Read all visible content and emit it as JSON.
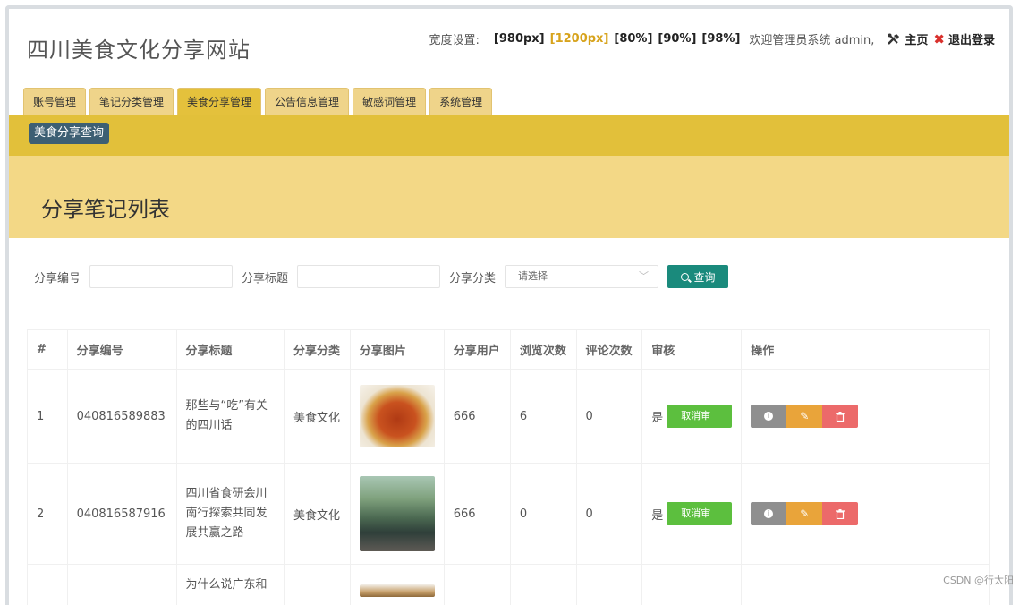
{
  "site": {
    "title": "四川美食文化分享网站"
  },
  "topbar": {
    "width_label": "宽度设置:",
    "width_options": [
      "[980px]",
      "[1200px]",
      "[80%]",
      "[90%]",
      "[98%]"
    ],
    "welcome": "欢迎管理员系统 admin,",
    "home": "主页",
    "logout": "退出登录"
  },
  "tabs": [
    "账号管理",
    "笔记分类管理",
    "美食分享管理",
    "公告信息管理",
    "敏感词管理",
    "系统管理"
  ],
  "subnav": {
    "button": "美食分享查询"
  },
  "page": {
    "title": "分享笔记列表"
  },
  "filters": {
    "id_label": "分享编号",
    "title_label": "分享标题",
    "category_label": "分享分类",
    "category_placeholder": "请选择",
    "search_button": "查询"
  },
  "table": {
    "headers": [
      "#",
      "分享编号",
      "分享标题",
      "分享分类",
      "分享图片",
      "分享用户",
      "浏览次数",
      "评论次数",
      "审核",
      "操作"
    ],
    "rows": [
      {
        "index": "1",
        "id": "040816589883",
        "title": "那些与“吃”有关的四川话",
        "category": "美食文化",
        "user": "666",
        "views": "6",
        "comments": "0",
        "approved": "是",
        "approve_action": "取消审核"
      },
      {
        "index": "2",
        "id": "040816587916",
        "title": "四川省食研会川南行探索共同发展共赢之路",
        "category": "美食文化",
        "user": "666",
        "views": "0",
        "comments": "0",
        "approved": "是",
        "approve_action": "取消审核"
      },
      {
        "index": "",
        "id": "",
        "title": "为什么说广东和",
        "category": "",
        "user": "",
        "views": "",
        "comments": "",
        "approved": "",
        "approve_action": ""
      }
    ]
  },
  "watermark": "CSDN @行太阳",
  "colors": {
    "accent": "#e2c03a",
    "banner": "#f3d886",
    "search": "#1a8a7c",
    "approve": "#5cbf3e"
  }
}
